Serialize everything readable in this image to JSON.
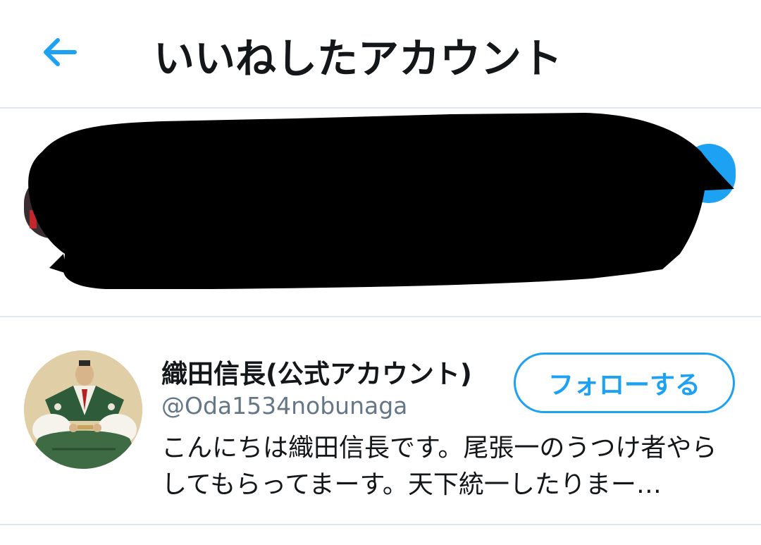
{
  "header": {
    "title": "いいねしたアカウント",
    "back_icon": "arrow-left-icon",
    "accent_color": "#1da1f2"
  },
  "accounts": [
    {
      "redacted": true
    },
    {
      "name": "織田信長(公式アカウント)",
      "handle": "@Oda1534nobunaga",
      "bio": "こんにちは織田信長です。尾張一のうつけ者やらしてもらってまーす。天下統一したりまー…",
      "follow_label": "フォローする",
      "avatar_icon": "samurai-portrait-avatar"
    }
  ]
}
